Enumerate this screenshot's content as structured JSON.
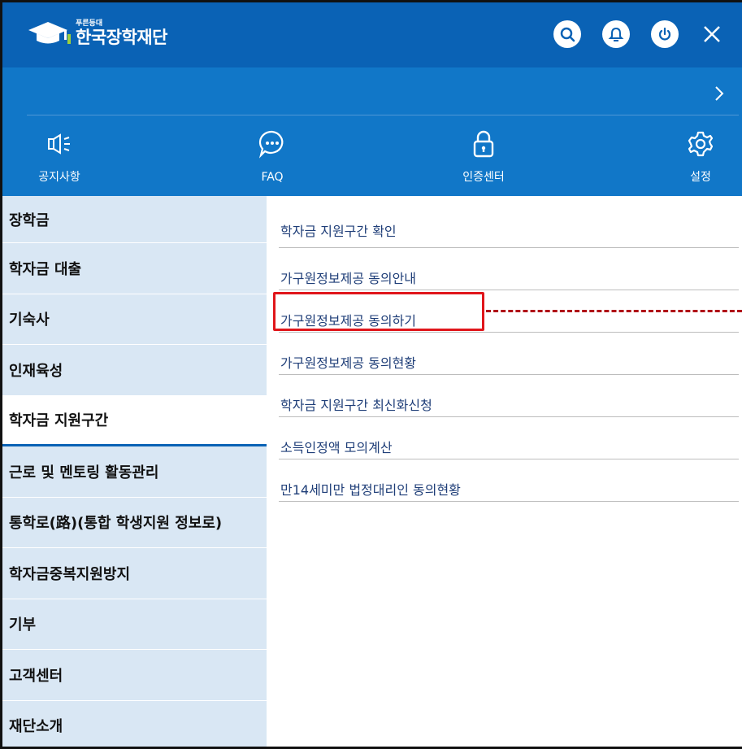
{
  "header": {
    "logo_sub": "푸른등대",
    "logo_name": "한국장학재단",
    "icons": [
      "search-icon",
      "bell-icon",
      "power-icon",
      "close-icon"
    ]
  },
  "quick_menu": [
    {
      "label": "공지사항",
      "icon": "megaphone-icon"
    },
    {
      "label": "FAQ",
      "icon": "chat-icon"
    },
    {
      "label": "인증센터",
      "icon": "lock-icon"
    },
    {
      "label": "설정",
      "icon": "gear-icon"
    }
  ],
  "left_nav": [
    {
      "label": "장학금"
    },
    {
      "label": "학자금 대출"
    },
    {
      "label": "기숙사"
    },
    {
      "label": "인재육성"
    },
    {
      "label": "학자금 지원구간",
      "active": true
    },
    {
      "label": "근로 및 멘토링 활동관리"
    },
    {
      "label": "통학로(路)(통합 학생지원 정보로)"
    },
    {
      "label": "학자금중복지원방지"
    },
    {
      "label": "기부"
    },
    {
      "label": "고객센터"
    },
    {
      "label": "재단소개"
    }
  ],
  "sub_menu": [
    {
      "label": "학자금 지원구간 확인"
    },
    {
      "label": "가구원정보제공 동의안내"
    },
    {
      "label": "가구원정보제공 동의하기",
      "highlighted": true
    },
    {
      "label": "가구원정보제공 동의현황"
    },
    {
      "label": "학자금 지원구간 최신화신청"
    },
    {
      "label": "소득인정액 모의계산"
    },
    {
      "label": "만14세미만 법정대리인 동의현황"
    }
  ],
  "colors": {
    "header_bg": "#0a62b5",
    "band_bg": "#1177c8",
    "nav_bg": "#d9e7f4",
    "sub_text": "#1f3e78",
    "highlight": "#e0161b"
  }
}
